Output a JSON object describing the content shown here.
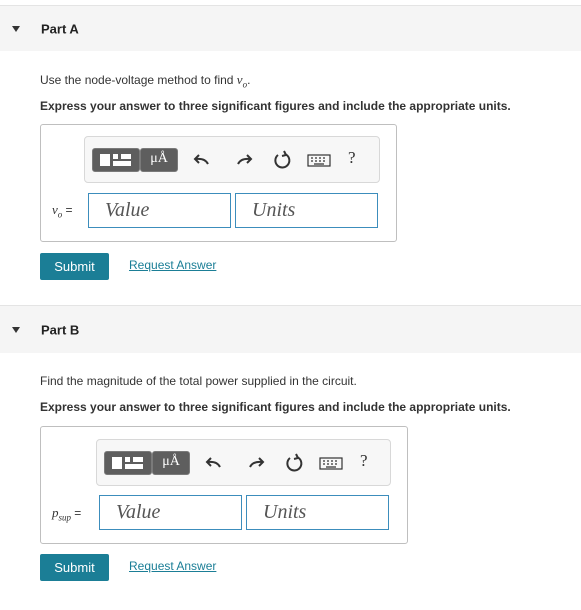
{
  "partA": {
    "title": "Part A",
    "instruction_pre": "Use the node-voltage method to find ",
    "instruction_var": "v",
    "instruction_sub": "o",
    "instruction_post": ".",
    "express": "Express your answer to three significant figures and include the appropriate units.",
    "var_label": "v",
    "var_sub": "o",
    "equals": "=",
    "value_placeholder": "Value",
    "units_placeholder": "Units",
    "submit": "Submit",
    "request": "Request Answer"
  },
  "partB": {
    "title": "Part B",
    "instruction": "Find the magnitude of the total power supplied in the circuit.",
    "express": "Express your answer to three significant figures and include the appropriate units.",
    "var_label": "p",
    "var_sub": "sup",
    "equals": "=",
    "value_placeholder": "Value",
    "units_placeholder": "Units",
    "submit": "Submit",
    "request": "Request Answer"
  },
  "toolbar": {
    "units_button": "μÅ",
    "help": "?",
    "icons": [
      "templates-icon",
      "units-icon",
      "undo-icon",
      "redo-icon",
      "reset-icon",
      "keyboard-icon",
      "help-icon"
    ]
  },
  "colors": {
    "accent": "#1b7e96",
    "field_border": "#3c8dbc",
    "header_bg": "#f5f5f5"
  }
}
